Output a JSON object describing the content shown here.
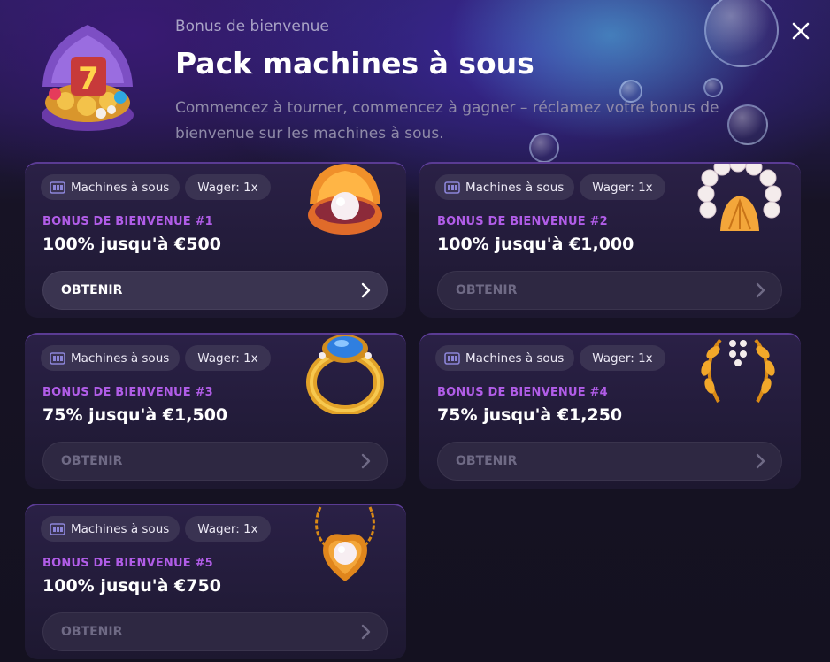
{
  "header": {
    "eyebrow": "Bonus de bienvenue",
    "title": "Pack machines à sous",
    "subtitle": "Commencez à tourner, commencez à gagner – réclamez votre bonus de bienvenue sur les machines à sous."
  },
  "cards": [
    {
      "chip_category": "Machines à sous",
      "chip_wager": "Wager: 1x",
      "label": "BONUS DE BIENVENUE #1",
      "amount": "100% jusqu'à €500",
      "button": "OBTENIR",
      "art_icon": "pearl-shell-icon",
      "active": true
    },
    {
      "chip_category": "Machines à sous",
      "chip_wager": "Wager: 1x",
      "label": "BONUS DE BIENVENUE #2",
      "amount": "100% jusqu'à €1,000",
      "button": "OBTENIR",
      "art_icon": "pearl-necklace-icon",
      "active": false
    },
    {
      "chip_category": "Machines à sous",
      "chip_wager": "Wager: 1x",
      "label": "BONUS DE BIENVENUE #3",
      "amount": "75% jusqu'à €1,500",
      "button": "OBTENIR",
      "art_icon": "sapphire-ring-icon",
      "active": false
    },
    {
      "chip_category": "Machines à sous",
      "chip_wager": "Wager: 1x",
      "label": "BONUS DE BIENVENUE #4",
      "amount": "75% jusqu'à €1,250",
      "button": "OBTENIR",
      "art_icon": "laurel-wreath-icon",
      "active": false
    },
    {
      "chip_category": "Machines à sous",
      "chip_wager": "Wager: 1x",
      "label": "BONUS DE BIENVENUE #5",
      "amount": "100% jusqu'à €750",
      "button": "OBTENIR",
      "art_icon": "pearl-pendant-icon",
      "active": false
    }
  ],
  "colors": {
    "accent_label": "#b15de8",
    "card_bg": "#1d1830",
    "chip_bg": "#3a3352"
  }
}
